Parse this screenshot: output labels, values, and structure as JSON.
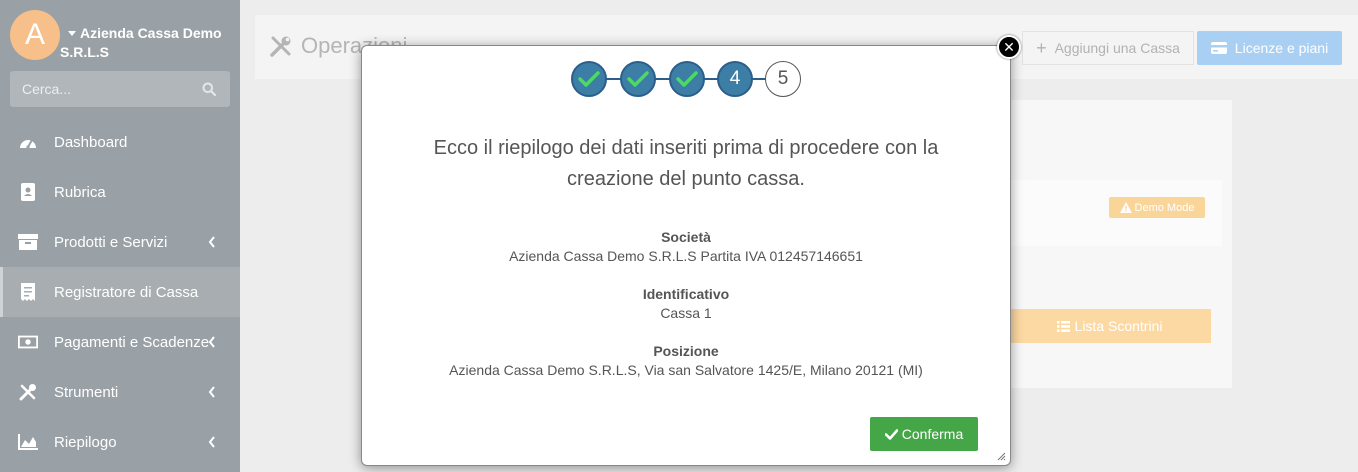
{
  "sidebar": {
    "avatar_letter": "A",
    "company_name": "Azienda Cassa Demo S.R.L.S",
    "search_placeholder": "Cerca...",
    "items": [
      {
        "label": "Dashboard",
        "icon": "gauge-icon",
        "has_submenu": false,
        "active": false
      },
      {
        "label": "Rubrica",
        "icon": "address-book-icon",
        "has_submenu": false,
        "active": false
      },
      {
        "label": "Prodotti e Servizi",
        "icon": "box-icon",
        "has_submenu": true,
        "active": false
      },
      {
        "label": "Registratore di Cassa",
        "icon": "receipt-icon",
        "has_submenu": false,
        "active": true
      },
      {
        "label": "Pagamenti e Scadenze",
        "icon": "money-icon",
        "has_submenu": true,
        "active": false
      },
      {
        "label": "Strumenti",
        "icon": "tools-icon",
        "has_submenu": true,
        "active": false
      },
      {
        "label": "Riepilogo",
        "icon": "area-chart-icon",
        "has_submenu": true,
        "active": false
      }
    ]
  },
  "header": {
    "title": "Operazioni",
    "add_button": "Aggiungi una Cassa",
    "license_button": "Licenze e piani"
  },
  "background_card": {
    "demo_badge": "Demo Mode",
    "list_button": "Lista Scontrini"
  },
  "modal": {
    "steps": [
      {
        "state": "done",
        "label": ""
      },
      {
        "state": "done",
        "label": ""
      },
      {
        "state": "done",
        "label": ""
      },
      {
        "state": "current",
        "label": "4"
      },
      {
        "state": "todo",
        "label": "5"
      }
    ],
    "heading_line1": "Ecco il riepilogo dei dati inseriti prima di procedere con la",
    "heading_line2": "creazione del punto cassa.",
    "fields": {
      "societa_label": "Società",
      "societa_value": "Azienda Cassa Demo S.R.L.S Partita IVA 012457146651",
      "id_label": "Identificativo",
      "id_value": "Cassa 1",
      "pos_label": "Posizione",
      "pos_value": "Azienda Cassa Demo S.R.L.S, Via san Salvatore 1425/E, Milano 20121 (MI)"
    },
    "confirm_button": "Conferma"
  },
  "colors": {
    "sidebar_bg": "#9aa1a6",
    "step_fill": "#3d7ea6",
    "check_green": "#4cd964",
    "confirm_green": "#45a648",
    "license_blue": "#a9cff2",
    "warning_orange": "#fad59a"
  }
}
